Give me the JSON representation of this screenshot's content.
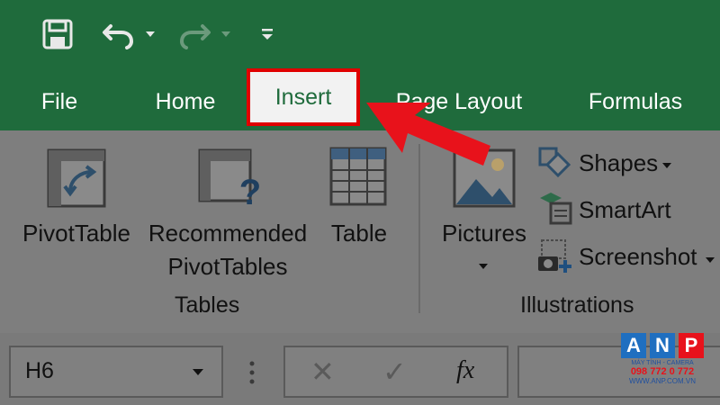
{
  "quick_access": {
    "save_icon": "save-icon",
    "undo_icon": "undo-icon",
    "redo_icon": "redo-icon",
    "customize_icon": "customize-qat-icon"
  },
  "tabs": [
    {
      "label": "File"
    },
    {
      "label": "Home"
    },
    {
      "label": "Insert",
      "active": true
    },
    {
      "label": "Page Layout"
    },
    {
      "label": "Formulas"
    }
  ],
  "ribbon": {
    "tables_group": {
      "label": "Tables",
      "pivot_table": "PivotTable",
      "recommended_line1": "Recommended",
      "recommended_line2": "PivotTables",
      "table": "Table"
    },
    "illustrations_group": {
      "label": "Illustrations",
      "pictures": "Pictures",
      "shapes": "Shapes",
      "smartart": "SmartArt",
      "screenshot": "Screenshot"
    }
  },
  "formula_bar": {
    "name_box_value": "H6",
    "cancel_symbol": "✕",
    "enter_symbol": "✓",
    "fx_symbol": "fx"
  },
  "watermark": {
    "letters": [
      "A",
      "N",
      "P"
    ],
    "line1": "MÁY TÍNH - CAMERA",
    "line2": "098 772 0 772",
    "line3": "WWW.ANP.COM.VN"
  },
  "colors": {
    "title_bar": "#1f6b3c",
    "highlight": "#e00000",
    "ribbon_dim": "#7e7e7e"
  }
}
